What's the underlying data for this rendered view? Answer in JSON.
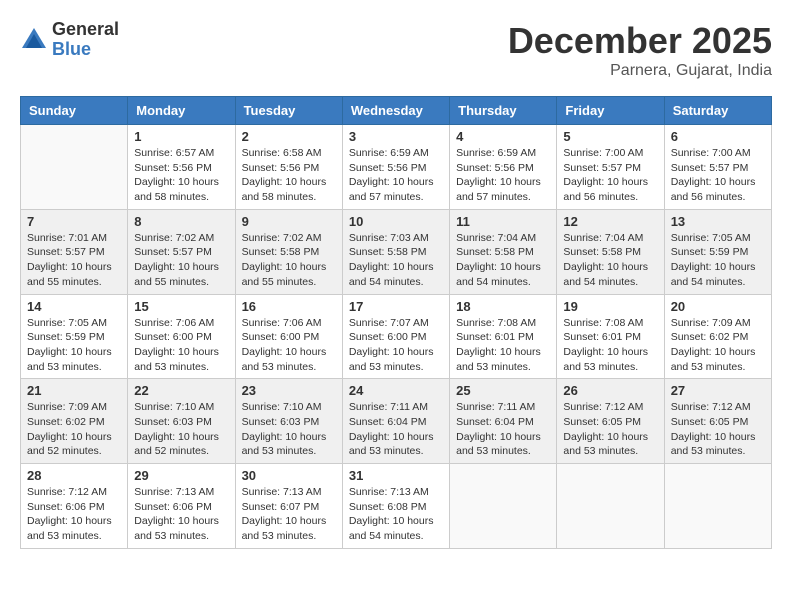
{
  "header": {
    "logo_general": "General",
    "logo_blue": "Blue",
    "month_title": "December 2025",
    "location": "Parnera, Gujarat, India"
  },
  "calendar": {
    "days_of_week": [
      "Sunday",
      "Monday",
      "Tuesday",
      "Wednesday",
      "Thursday",
      "Friday",
      "Saturday"
    ],
    "weeks": [
      [
        {
          "day": "",
          "info": ""
        },
        {
          "day": "1",
          "info": "Sunrise: 6:57 AM\nSunset: 5:56 PM\nDaylight: 10 hours\nand 58 minutes."
        },
        {
          "day": "2",
          "info": "Sunrise: 6:58 AM\nSunset: 5:56 PM\nDaylight: 10 hours\nand 58 minutes."
        },
        {
          "day": "3",
          "info": "Sunrise: 6:59 AM\nSunset: 5:56 PM\nDaylight: 10 hours\nand 57 minutes."
        },
        {
          "day": "4",
          "info": "Sunrise: 6:59 AM\nSunset: 5:56 PM\nDaylight: 10 hours\nand 57 minutes."
        },
        {
          "day": "5",
          "info": "Sunrise: 7:00 AM\nSunset: 5:57 PM\nDaylight: 10 hours\nand 56 minutes."
        },
        {
          "day": "6",
          "info": "Sunrise: 7:00 AM\nSunset: 5:57 PM\nDaylight: 10 hours\nand 56 minutes."
        }
      ],
      [
        {
          "day": "7",
          "info": "Sunrise: 7:01 AM\nSunset: 5:57 PM\nDaylight: 10 hours\nand 55 minutes."
        },
        {
          "day": "8",
          "info": "Sunrise: 7:02 AM\nSunset: 5:57 PM\nDaylight: 10 hours\nand 55 minutes."
        },
        {
          "day": "9",
          "info": "Sunrise: 7:02 AM\nSunset: 5:58 PM\nDaylight: 10 hours\nand 55 minutes."
        },
        {
          "day": "10",
          "info": "Sunrise: 7:03 AM\nSunset: 5:58 PM\nDaylight: 10 hours\nand 54 minutes."
        },
        {
          "day": "11",
          "info": "Sunrise: 7:04 AM\nSunset: 5:58 PM\nDaylight: 10 hours\nand 54 minutes."
        },
        {
          "day": "12",
          "info": "Sunrise: 7:04 AM\nSunset: 5:58 PM\nDaylight: 10 hours\nand 54 minutes."
        },
        {
          "day": "13",
          "info": "Sunrise: 7:05 AM\nSunset: 5:59 PM\nDaylight: 10 hours\nand 54 minutes."
        }
      ],
      [
        {
          "day": "14",
          "info": "Sunrise: 7:05 AM\nSunset: 5:59 PM\nDaylight: 10 hours\nand 53 minutes."
        },
        {
          "day": "15",
          "info": "Sunrise: 7:06 AM\nSunset: 6:00 PM\nDaylight: 10 hours\nand 53 minutes."
        },
        {
          "day": "16",
          "info": "Sunrise: 7:06 AM\nSunset: 6:00 PM\nDaylight: 10 hours\nand 53 minutes."
        },
        {
          "day": "17",
          "info": "Sunrise: 7:07 AM\nSunset: 6:00 PM\nDaylight: 10 hours\nand 53 minutes."
        },
        {
          "day": "18",
          "info": "Sunrise: 7:08 AM\nSunset: 6:01 PM\nDaylight: 10 hours\nand 53 minutes."
        },
        {
          "day": "19",
          "info": "Sunrise: 7:08 AM\nSunset: 6:01 PM\nDaylight: 10 hours\nand 53 minutes."
        },
        {
          "day": "20",
          "info": "Sunrise: 7:09 AM\nSunset: 6:02 PM\nDaylight: 10 hours\nand 53 minutes."
        }
      ],
      [
        {
          "day": "21",
          "info": "Sunrise: 7:09 AM\nSunset: 6:02 PM\nDaylight: 10 hours\nand 52 minutes."
        },
        {
          "day": "22",
          "info": "Sunrise: 7:10 AM\nSunset: 6:03 PM\nDaylight: 10 hours\nand 52 minutes."
        },
        {
          "day": "23",
          "info": "Sunrise: 7:10 AM\nSunset: 6:03 PM\nDaylight: 10 hours\nand 53 minutes."
        },
        {
          "day": "24",
          "info": "Sunrise: 7:11 AM\nSunset: 6:04 PM\nDaylight: 10 hours\nand 53 minutes."
        },
        {
          "day": "25",
          "info": "Sunrise: 7:11 AM\nSunset: 6:04 PM\nDaylight: 10 hours\nand 53 minutes."
        },
        {
          "day": "26",
          "info": "Sunrise: 7:12 AM\nSunset: 6:05 PM\nDaylight: 10 hours\nand 53 minutes."
        },
        {
          "day": "27",
          "info": "Sunrise: 7:12 AM\nSunset: 6:05 PM\nDaylight: 10 hours\nand 53 minutes."
        }
      ],
      [
        {
          "day": "28",
          "info": "Sunrise: 7:12 AM\nSunset: 6:06 PM\nDaylight: 10 hours\nand 53 minutes."
        },
        {
          "day": "29",
          "info": "Sunrise: 7:13 AM\nSunset: 6:06 PM\nDaylight: 10 hours\nand 53 minutes."
        },
        {
          "day": "30",
          "info": "Sunrise: 7:13 AM\nSunset: 6:07 PM\nDaylight: 10 hours\nand 53 minutes."
        },
        {
          "day": "31",
          "info": "Sunrise: 7:13 AM\nSunset: 6:08 PM\nDaylight: 10 hours\nand 54 minutes."
        },
        {
          "day": "",
          "info": ""
        },
        {
          "day": "",
          "info": ""
        },
        {
          "day": "",
          "info": ""
        }
      ]
    ]
  }
}
